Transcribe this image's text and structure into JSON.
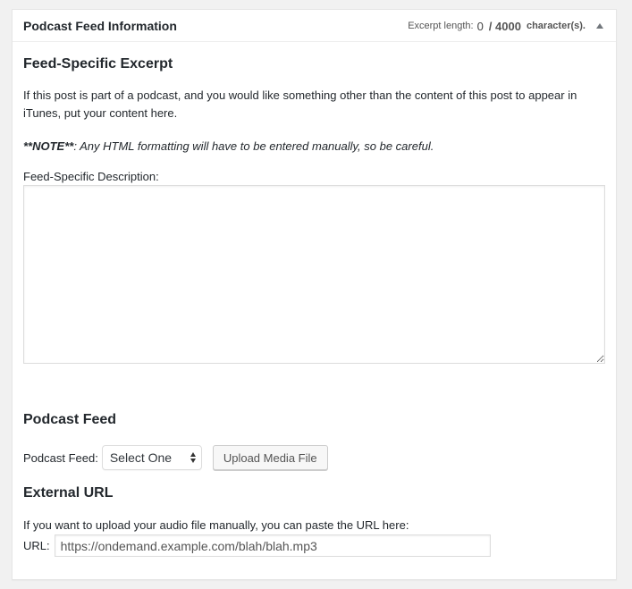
{
  "header": {
    "title": "Podcast Feed Information",
    "excerpt_label": "Excerpt length:",
    "excerpt_count": "0",
    "excerpt_max": "/ 4000",
    "excerpt_unit": "character(s)."
  },
  "excerpt_section": {
    "heading": "Feed-Specific Excerpt",
    "intro": "If this post is part of a podcast, and you would like something other than the content of this post to appear in iTunes, put your content here.",
    "note_bold": "**NOTE**",
    "note_text": ": Any HTML formatting will have to be entered manually, so be careful.",
    "description_label": "Feed-Specific Description:",
    "description_value": ""
  },
  "podcast_feed_section": {
    "heading": "Podcast Feed",
    "feed_label": "Podcast Feed:",
    "feed_selected": "Select One",
    "upload_button": "Upload Media File"
  },
  "external_url_section": {
    "heading": "External URL",
    "help_text": "If you want to upload your audio file manually, you can paste the URL here:",
    "url_label": "URL:",
    "url_value": "https://ondemand.example.com/blah/blah.mp3"
  }
}
